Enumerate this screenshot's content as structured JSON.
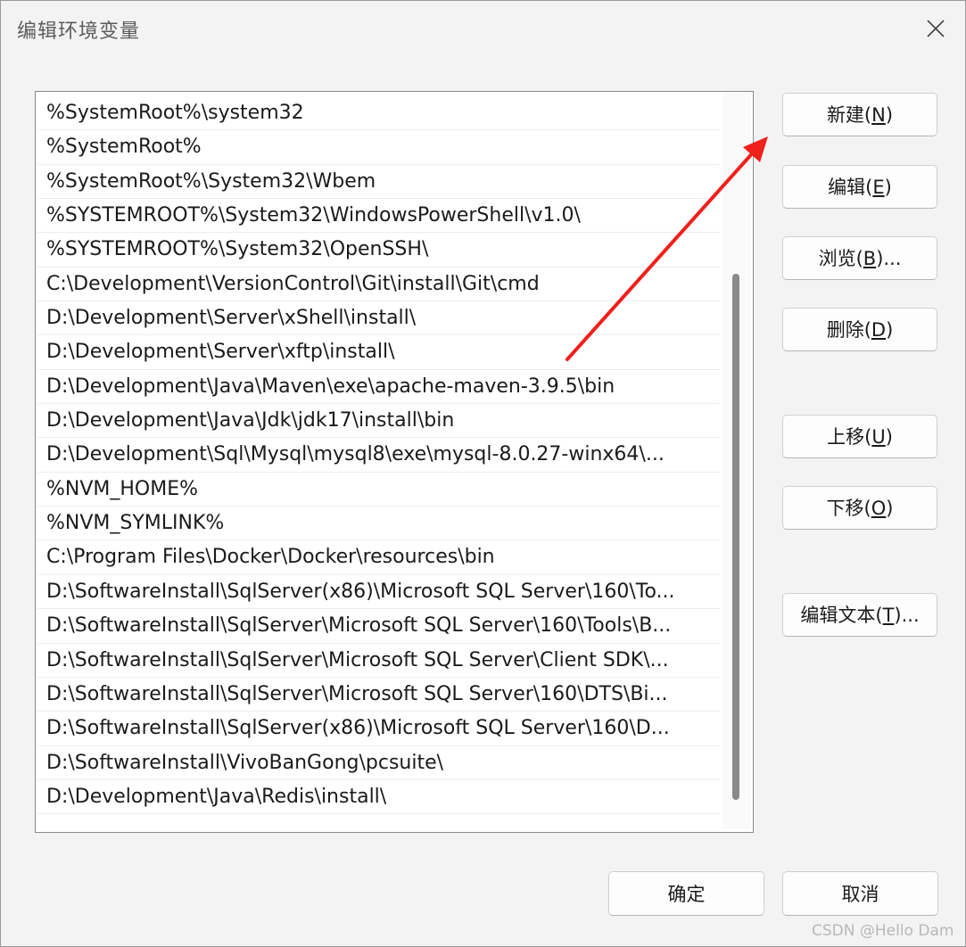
{
  "window": {
    "title": "编辑环境变量"
  },
  "paths": [
    "%SystemRoot%\\system32",
    "%SystemRoot%",
    "%SystemRoot%\\System32\\Wbem",
    "%SYSTEMROOT%\\System32\\WindowsPowerShell\\v1.0\\",
    "%SYSTEMROOT%\\System32\\OpenSSH\\",
    "C:\\Development\\VersionControl\\Git\\install\\Git\\cmd",
    "D:\\Development\\Server\\xShell\\install\\",
    "D:\\Development\\Server\\xftp\\install\\",
    "D:\\Development\\Java\\Maven\\exe\\apache-maven-3.9.5\\bin",
    "D:\\Development\\Java\\Jdk\\jdk17\\install\\bin",
    "D:\\Development\\Sql\\Mysql\\mysql8\\exe\\mysql-8.0.27-winx64\\...",
    "%NVM_HOME%",
    "%NVM_SYMLINK%",
    "C:\\Program Files\\Docker\\Docker\\resources\\bin",
    "D:\\SoftwareInstall\\SqlServer(x86)\\Microsoft SQL Server\\160\\To...",
    "D:\\SoftwareInstall\\SqlServer\\Microsoft SQL Server\\160\\Tools\\B...",
    "D:\\SoftwareInstall\\SqlServer\\Microsoft SQL Server\\Client SDK\\...",
    "D:\\SoftwareInstall\\SqlServer\\Microsoft SQL Server\\160\\DTS\\Bi...",
    "D:\\SoftwareInstall\\SqlServer(x86)\\Microsoft SQL Server\\160\\D...",
    "D:\\SoftwareInstall\\VivoBanGong\\pcsuite\\",
    "D:\\Development\\Java\\Redis\\install\\"
  ],
  "buttons": {
    "new": {
      "pre": "新建(",
      "key": "N",
      "post": ")"
    },
    "edit": {
      "pre": "编辑(",
      "key": "E",
      "post": ")"
    },
    "browse": {
      "pre": "浏览(",
      "key": "B",
      "post": ")..."
    },
    "delete": {
      "pre": "删除(",
      "key": "D",
      "post": ")"
    },
    "move_up": {
      "pre": "上移(",
      "key": "U",
      "post": ")"
    },
    "move_down": {
      "pre": "下移(",
      "key": "O",
      "post": ")"
    },
    "edit_text": {
      "pre": "编辑文本(",
      "key": "T",
      "post": ")..."
    },
    "ok": "确定",
    "cancel": "取消"
  },
  "watermark": "CSDN @Hello Dam",
  "icons": {
    "close": "close-icon",
    "annotation": "red-arrow-icon"
  },
  "colors": {
    "arrow": "#f0201b",
    "scroll_thumb": "#8a8a8a"
  }
}
